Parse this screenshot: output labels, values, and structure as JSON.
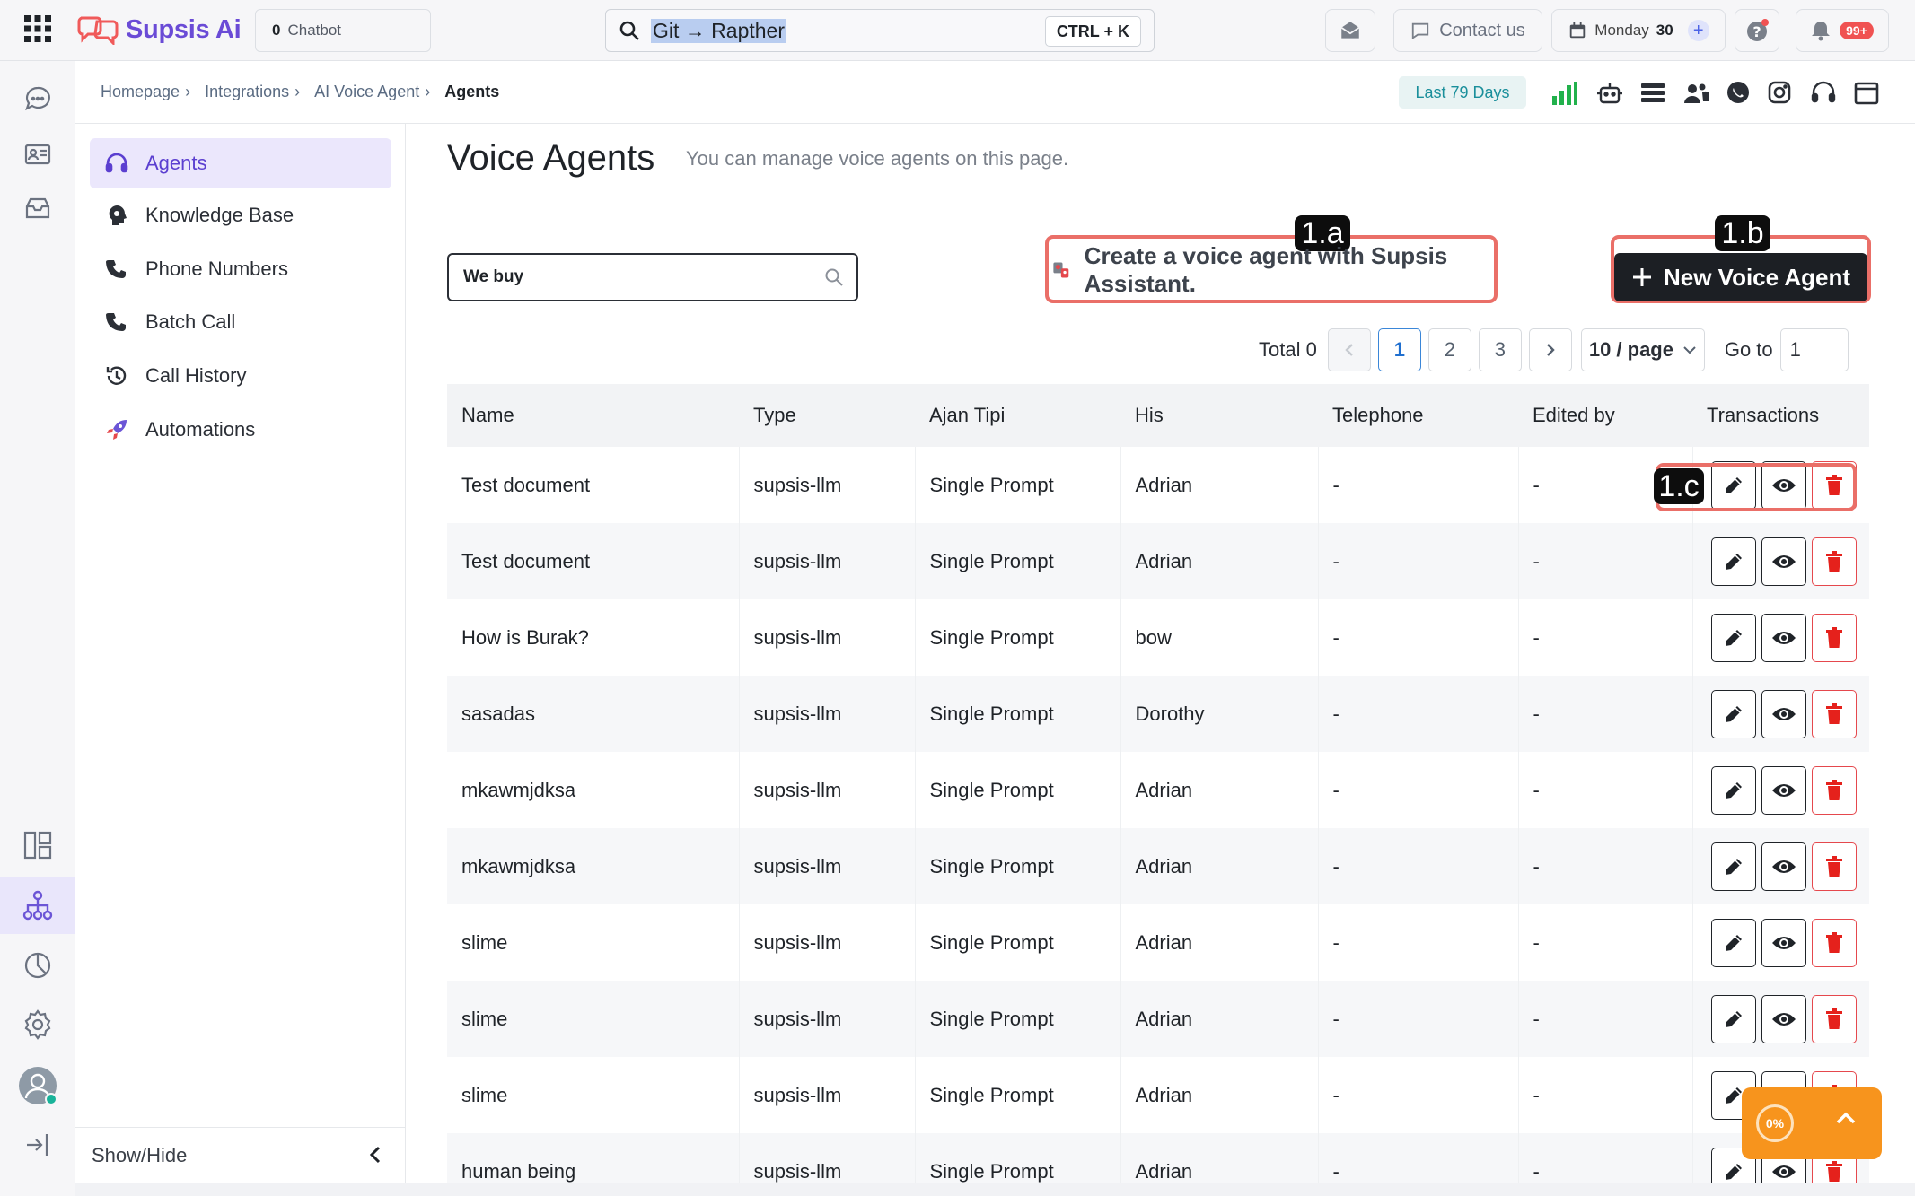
{
  "app": {
    "name": "Supsis Ai"
  },
  "topbar": {
    "chatbot_count": "0",
    "chatbot_label": "Chatbot",
    "search_query": "Git → Rapther",
    "search_shortcut": "CTRL + K",
    "contact_label": "Contact us",
    "date_day": "Monday",
    "date_num": "30",
    "notif_badge": "99+"
  },
  "breadcrumb": [
    {
      "label": "Homepage"
    },
    {
      "label": "Integrations"
    },
    {
      "label": "AI Voice Agent"
    },
    {
      "label": "Agents"
    }
  ],
  "subbar": {
    "range_label": "Last 79 Days"
  },
  "sidemenu": {
    "items": [
      {
        "label": "Agents",
        "icon": "headset-icon"
      },
      {
        "label": "Knowledge Base",
        "icon": "brain-head-icon"
      },
      {
        "label": "Phone Numbers",
        "icon": "phone-icon"
      },
      {
        "label": "Batch Call",
        "icon": "phone-icon"
      },
      {
        "label": "Call History",
        "icon": "history-icon"
      },
      {
        "label": "Automations",
        "icon": "rocket-icon"
      }
    ],
    "showhide_label": "Show/Hide"
  },
  "main": {
    "title": "Voice Agents",
    "subtitle": "You can manage voice agents on this page.",
    "search_value": "We buy",
    "assistant_button": "Create a voice agent with Supsis Assistant.",
    "new_button": "New Voice Agent",
    "annotations": {
      "a": "1.a",
      "b": "1.b",
      "c": "1.c"
    }
  },
  "pagination": {
    "total_label": "Total 0",
    "pages": [
      "1",
      "2",
      "3"
    ],
    "current_page": "1",
    "page_size": "10 / page",
    "goto_label": "Go to",
    "goto_value": "1"
  },
  "table": {
    "columns": [
      "Name",
      "Type",
      "Ajan Tipi",
      "His",
      "Telephone",
      "Edited by",
      "Transactions"
    ],
    "rows": [
      [
        "Test document",
        "supsis-llm",
        "Single Prompt",
        "Adrian",
        "-",
        "-"
      ],
      [
        "Test document",
        "supsis-llm",
        "Single Prompt",
        "Adrian",
        "-",
        "-"
      ],
      [
        "How is Burak?",
        "supsis-llm",
        "Single Prompt",
        "bow",
        "-",
        "-"
      ],
      [
        "sasadas",
        "supsis-llm",
        "Single Prompt",
        "Dorothy",
        "-",
        "-"
      ],
      [
        "mkawmjdksa",
        "supsis-llm",
        "Single Prompt",
        "Adrian",
        "-",
        "-"
      ],
      [
        "mkawmjdksa",
        "supsis-llm",
        "Single Prompt",
        "Adrian",
        "-",
        "-"
      ],
      [
        "slime",
        "supsis-llm",
        "Single Prompt",
        "Adrian",
        "-",
        "-"
      ],
      [
        "slime",
        "supsis-llm",
        "Single Prompt",
        "Adrian",
        "-",
        "-"
      ],
      [
        "slime",
        "supsis-llm",
        "Single Prompt",
        "Adrian",
        "-",
        "-"
      ],
      [
        "human being",
        "supsis-llm",
        "Single Prompt",
        "Adrian",
        "-",
        "-"
      ]
    ]
  },
  "widget": {
    "progress_label": "0%"
  },
  "colors": {
    "accent": "#6a4bd6",
    "annotation": "#ea6f68",
    "delete": "#e5484d",
    "widget": "#f7941d"
  }
}
